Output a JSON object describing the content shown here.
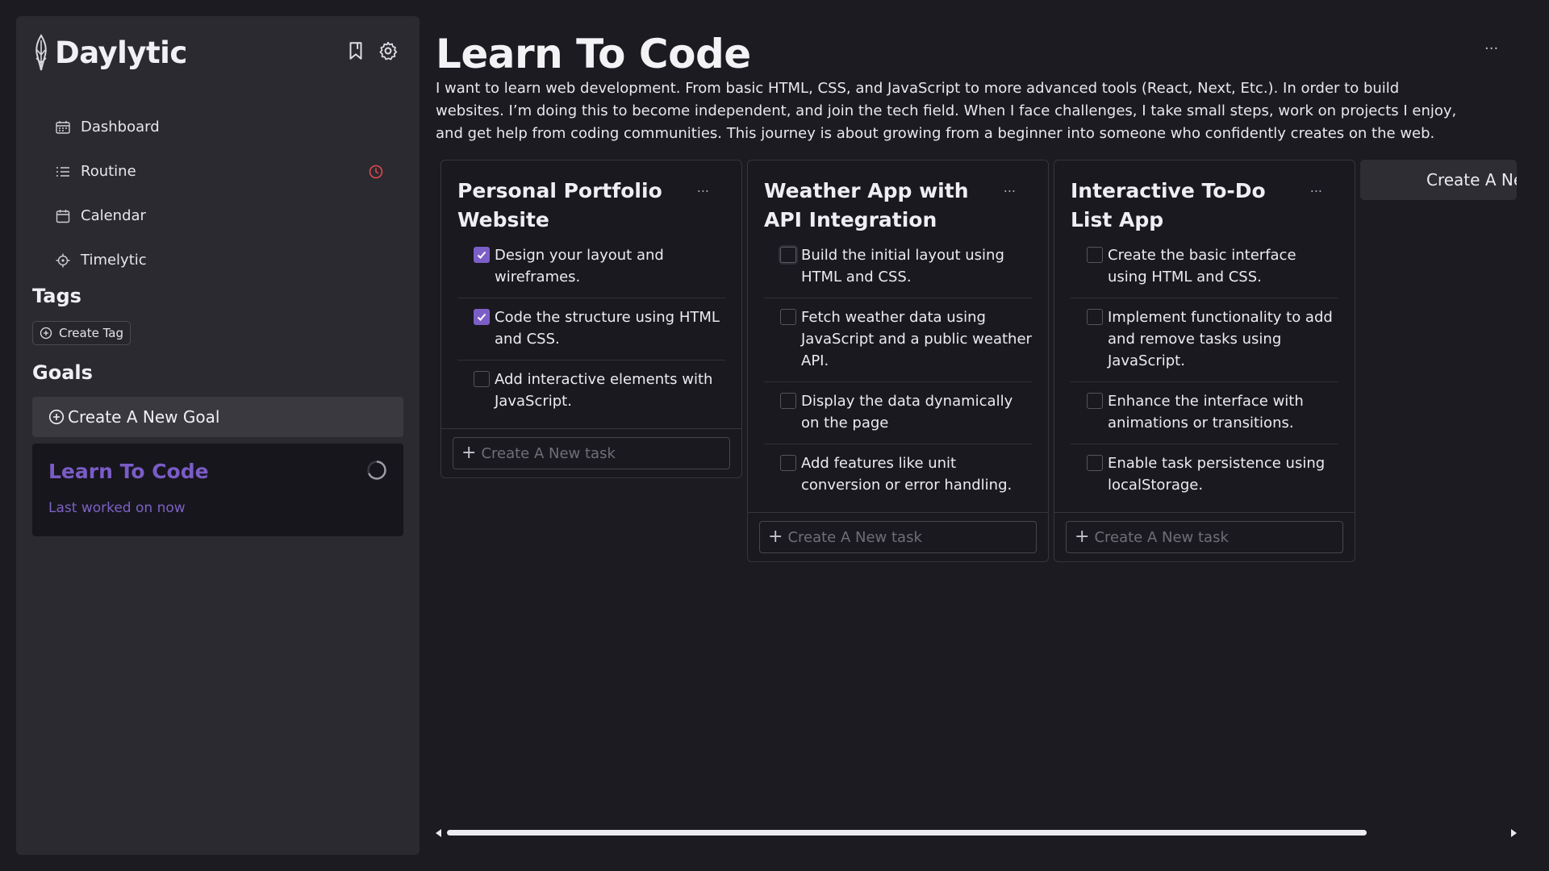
{
  "app": {
    "name": "Daylytic",
    "accent": "#7b5fc7"
  },
  "sidebar": {
    "top_icons": [
      "bookmark-icon",
      "gear-icon"
    ],
    "nav": [
      {
        "label": "Dashboard",
        "icon": "dashboard-icon"
      },
      {
        "label": "Routine",
        "icon": "list-icon",
        "badge_icon": "clock-alert-icon",
        "badge_color": "#e5484d"
      },
      {
        "label": "Calendar",
        "icon": "calendar-icon"
      },
      {
        "label": "Timelytic",
        "icon": "target-icon"
      }
    ],
    "tags_title": "Tags",
    "create_tag_label": "Create Tag",
    "goals_title": "Goals",
    "create_goal_label": "Create A New Goal",
    "goals": [
      {
        "title": "Learn To Code",
        "subtitle": "Last worked on now"
      }
    ]
  },
  "main": {
    "title": "Learn To Code",
    "menu": "...",
    "description": "I want to learn web development. From basic HTML, CSS, and JavaScript to more advanced tools (React, Next, Etc.). In order to build websites. I’m doing this to become independent, and join the tech field. When I face challenges, I take small steps, work on projects I enjoy, and get help from coding communities. This journey is about growing from a beginner into someone who confidently creates on the web.",
    "new_column_label": "Create A New",
    "new_task_placeholder": "Create A New task",
    "columns": [
      {
        "title": "Personal Portfolio Website",
        "menu": "...",
        "tasks": [
          {
            "text": "Design your layout and wireframes.",
            "checked": true
          },
          {
            "text": "Code the structure using HTML and CSS.",
            "checked": true
          },
          {
            "text": "Add interactive elements with JavaScript.",
            "checked": false
          }
        ]
      },
      {
        "title": "Weather App with API Integration",
        "menu": "...",
        "tasks": [
          {
            "text": "Build the initial layout using HTML and CSS.",
            "checked": false
          },
          {
            "text": "Fetch weather data using JavaScript and a public weather API.",
            "checked": false
          },
          {
            "text": "Display the data dynamically on the page",
            "checked": false
          },
          {
            "text": "Add features like unit conversion or error handling.",
            "checked": false
          }
        ]
      },
      {
        "title": "Interactive To-Do List App",
        "menu": "...",
        "tasks": [
          {
            "text": "Create the basic interface using HTML and CSS.",
            "checked": false
          },
          {
            "text": "Implement functionality to add and remove tasks using JavaScript.",
            "checked": false
          },
          {
            "text": "Enhance the interface with animations or transitions.",
            "checked": false
          },
          {
            "text": "Enable task persistence using localStorage.",
            "checked": false
          }
        ]
      }
    ]
  }
}
